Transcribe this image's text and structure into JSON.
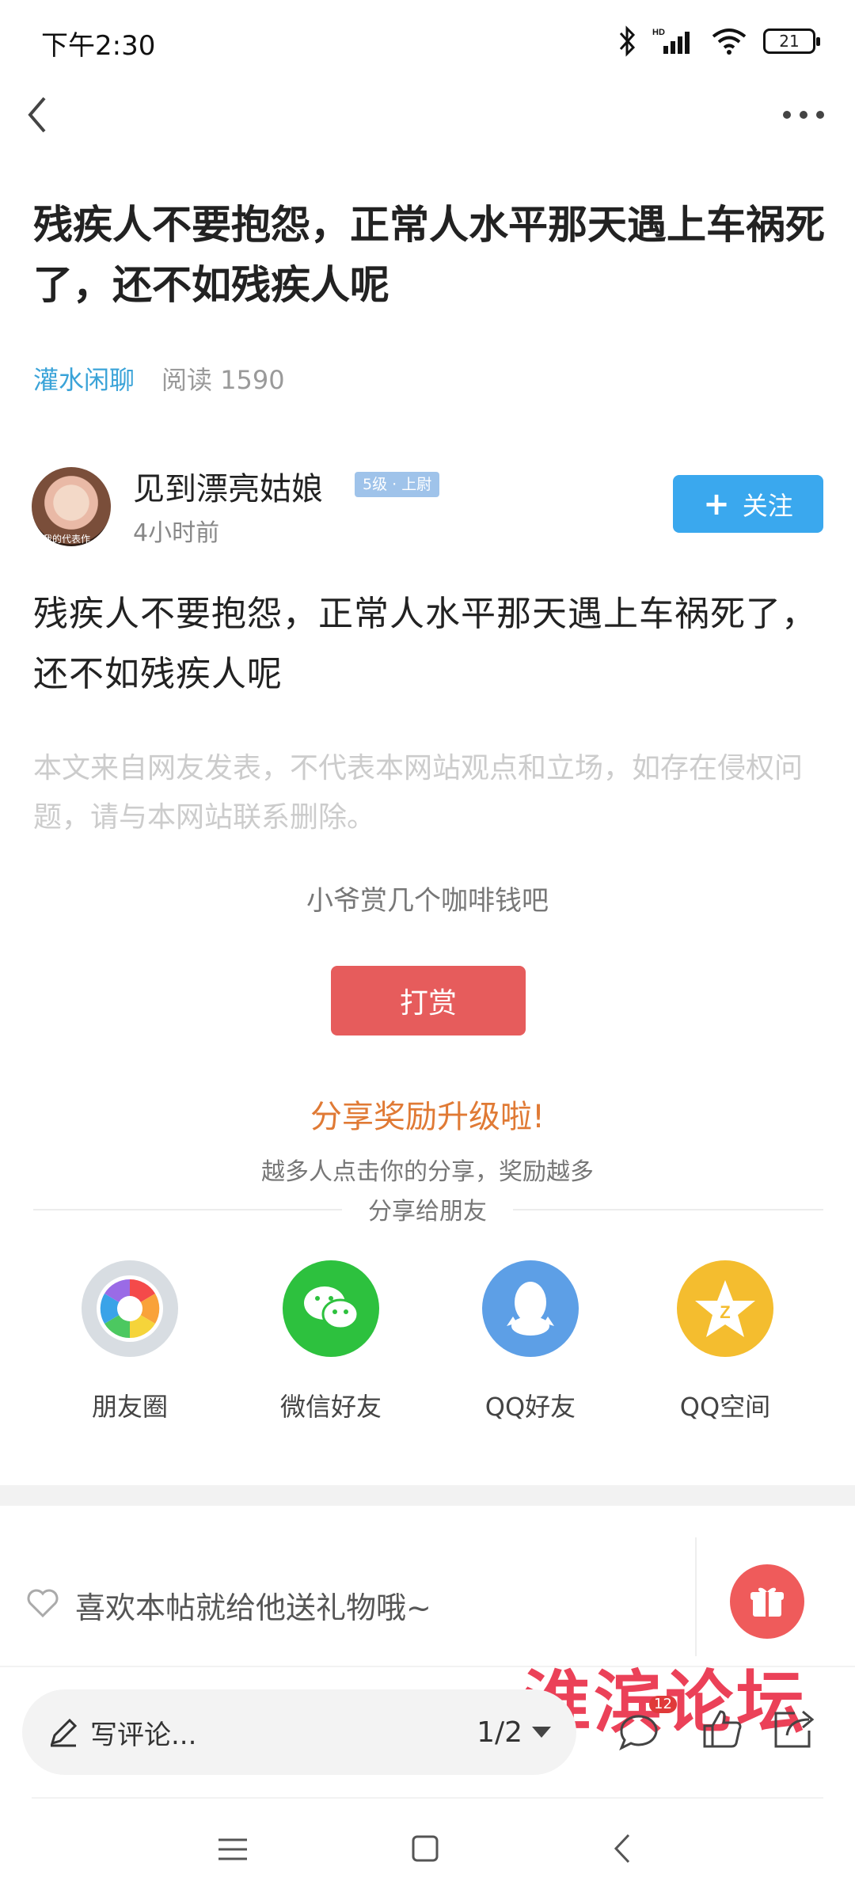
{
  "status_bar": {
    "time": "下午2:30",
    "battery": "21",
    "icons": [
      "bluetooth-icon",
      "signal-hd-icon",
      "wifi-icon",
      "battery-icon"
    ]
  },
  "top_bar": {
    "back_icon": "back-chevron-icon",
    "more_icon": "more-dots-icon"
  },
  "post": {
    "title": "残疾人不要抱怨，正常人水平那天遇上车祸死了，还不如残疾人呢",
    "category": "灌水闲聊",
    "read_count": "阅读 1590",
    "author": {
      "name": "见到漂亮姑娘",
      "level": "5级 · 上尉",
      "time": "4小时前",
      "avatar_caption": "我的代表作"
    },
    "follow_label": "关注",
    "body": "残疾人不要抱怨，正常人水平那天遇上车祸死了，还不如残疾人呢",
    "disclaimer": "本文来自网友发表，不代表本网站观点和立场，如存在侵权问题，请与本网站联系删除。"
  },
  "tip": {
    "hint": "小爷赏几个咖啡钱吧",
    "button_label": "打赏"
  },
  "share": {
    "title": "分享奖励升级啦!",
    "subtitle": "越多人点击你的分享，奖励越多",
    "share_to_label": "分享给朋友",
    "targets": [
      {
        "label": "朋友圈",
        "icon": "moments-icon",
        "color": "#d8dde2"
      },
      {
        "label": "微信好友",
        "icon": "wechat-icon",
        "color": "#2dc13e"
      },
      {
        "label": "QQ好友",
        "icon": "qq-icon",
        "color": "#5d9fe6"
      },
      {
        "label": "QQ空间",
        "icon": "qzone-icon",
        "color": "#f4bd2f"
      }
    ]
  },
  "gift": {
    "text": "喜欢本帖就给他送礼物哦~",
    "icon": "gift-icon"
  },
  "watermark": "淮滨论坛",
  "action_bar": {
    "comment_placeholder": "写评论...",
    "page_indicator": "1/2",
    "comment_count": "12"
  },
  "colors": {
    "accent_blue": "#3aa8ee",
    "tip_red": "#e65c5c",
    "share_orange": "#e07a35",
    "category_blue": "#3aa3d8"
  }
}
